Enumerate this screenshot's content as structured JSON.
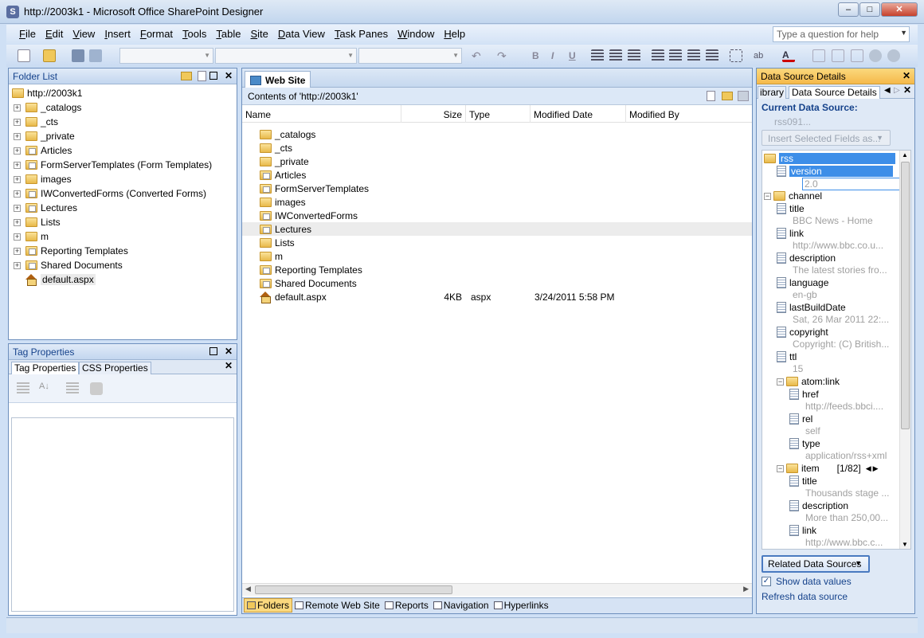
{
  "window": {
    "title": "http://2003k1 - Microsoft Office SharePoint Designer"
  },
  "menu": [
    "File",
    "Edit",
    "View",
    "Insert",
    "Format",
    "Tools",
    "Table",
    "Site",
    "Data View",
    "Task Panes",
    "Window",
    "Help"
  ],
  "help_placeholder": "Type a question for help",
  "folder_list": {
    "title": "Folder List",
    "root": "http://2003k1",
    "items": [
      "_catalogs",
      "_cts",
      "_private",
      "Articles",
      "FormServerTemplates (Form Templates)",
      "images",
      "IWConvertedForms (Converted Forms)",
      "Lectures",
      "Lists",
      "m",
      "Reporting Templates",
      "Shared Documents",
      "default.aspx"
    ]
  },
  "tag_properties": {
    "title": "Tag Properties",
    "tabs": [
      "Tag Properties",
      "CSS Properties"
    ]
  },
  "web_site": {
    "tab": "Web Site",
    "contents_label": "Contents of 'http://2003k1'",
    "columns": [
      "Name",
      "Size",
      "Type",
      "Modified Date",
      "Modified By"
    ],
    "rows": [
      {
        "name": "_catalogs"
      },
      {
        "name": "_cts"
      },
      {
        "name": "_private"
      },
      {
        "name": "Articles"
      },
      {
        "name": "FormServerTemplates"
      },
      {
        "name": "images"
      },
      {
        "name": "IWConvertedForms"
      },
      {
        "name": "Lectures"
      },
      {
        "name": "Lists"
      },
      {
        "name": "m"
      },
      {
        "name": "Reporting Templates"
      },
      {
        "name": "Shared Documents"
      },
      {
        "name": "default.aspx",
        "size": "4KB",
        "type": "aspx",
        "modified": "3/24/2011 5:58 PM"
      }
    ],
    "view_tabs": [
      "Folders",
      "Remote Web Site",
      "Reports",
      "Navigation",
      "Hyperlinks"
    ]
  },
  "data_source": {
    "title": "Data Source Details",
    "tabs": [
      "ibrary",
      "Data Source Details"
    ],
    "current_label": "Current Data Source:",
    "current_value": "rss091...",
    "insert_button": "Insert Selected Fields as...",
    "tree": [
      {
        "label": "rss"
      },
      {
        "label": "version",
        "value": "2.0"
      },
      {
        "label": "channel"
      },
      {
        "label": "title",
        "value": "BBC News - Home"
      },
      {
        "label": "link",
        "value": "http://www.bbc.co.u..."
      },
      {
        "label": "description",
        "value": "The latest stories fro..."
      },
      {
        "label": "language",
        "value": "en-gb"
      },
      {
        "label": "lastBuildDate",
        "value": "Sat, 26 Mar 2011 22:..."
      },
      {
        "label": "copyright",
        "value": "Copyright: (C) British..."
      },
      {
        "label": "ttl",
        "value": "15"
      },
      {
        "label": "atom:link"
      },
      {
        "label": "href",
        "value": "http://feeds.bbci...."
      },
      {
        "label": "rel",
        "value": "self"
      },
      {
        "label": "type",
        "value": "application/rss+xml"
      },
      {
        "label": "item",
        "pager": "[1/82]"
      },
      {
        "label": "title",
        "value": "Thousands stage ..."
      },
      {
        "label": "description",
        "value": "More than 250,00..."
      },
      {
        "label": "link",
        "value": "http://www.bbc.c..."
      }
    ],
    "related_button": "Related Data Sources",
    "show_values": "Show data values",
    "refresh": "Refresh data source"
  }
}
